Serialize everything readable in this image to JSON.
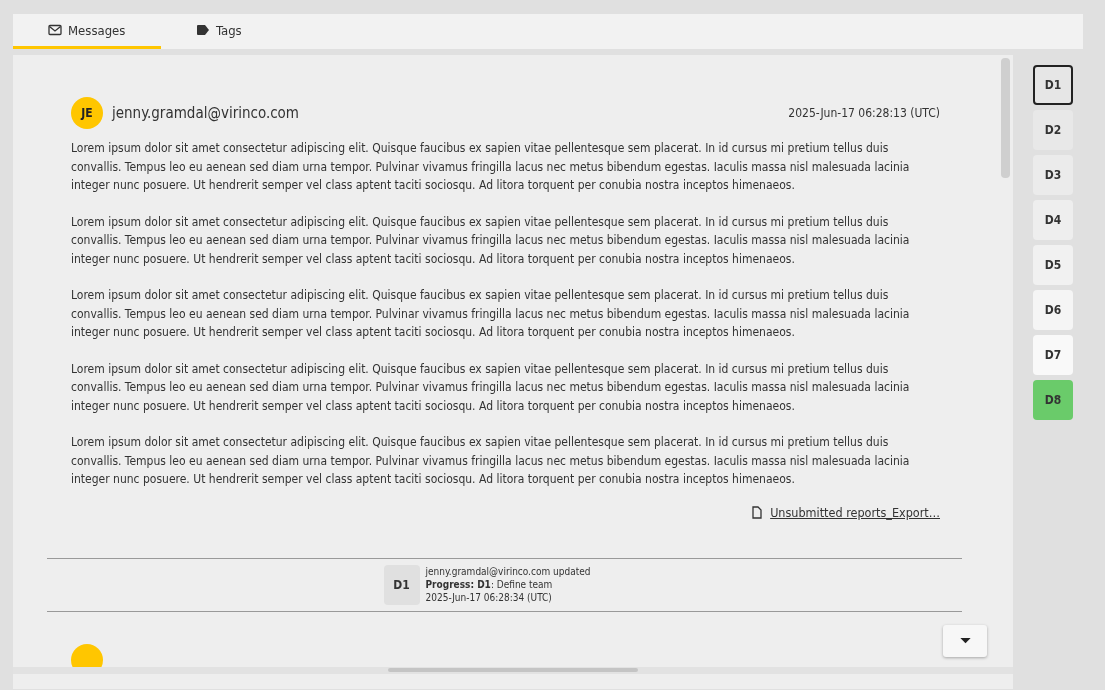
{
  "tabs": [
    {
      "label": "Messages",
      "kind": "mail",
      "selected": true
    },
    {
      "label": "Tags",
      "kind": "tag",
      "selected": false
    }
  ],
  "message": {
    "initials": "JE",
    "sender": "jenny.gramdal@virinco.com",
    "timestamp": "2025-Jun-17 06:28:13 (UTC)",
    "paragraphs": [
      "Lorem ipsum dolor sit amet consectetur adipiscing elit. Quisque faucibus ex sapien vitae pellentesque sem placerat. In id cursus mi pretium tellus duis convallis. Tempus leo eu aenean sed diam urna tempor. Pulvinar vivamus fringilla lacus nec metus bibendum egestas. Iaculis massa nisl malesuada lacinia integer nunc posuere. Ut hendrerit semper vel class aptent taciti sociosqu. Ad litora torquent per conubia nostra inceptos himenaeos.",
      "Lorem ipsum dolor sit amet consectetur adipiscing elit. Quisque faucibus ex sapien vitae pellentesque sem placerat. In id cursus mi pretium tellus duis convallis. Tempus leo eu aenean sed diam urna tempor. Pulvinar vivamus fringilla lacus nec metus bibendum egestas. Iaculis massa nisl malesuada lacinia integer nunc posuere. Ut hendrerit semper vel class aptent taciti sociosqu. Ad litora torquent per conubia nostra inceptos himenaeos.",
      "Lorem ipsum dolor sit amet consectetur adipiscing elit. Quisque faucibus ex sapien vitae pellentesque sem placerat. In id cursus mi pretium tellus duis convallis. Tempus leo eu aenean sed diam urna tempor. Pulvinar vivamus fringilla lacus nec metus bibendum egestas. Iaculis massa nisl malesuada lacinia integer nunc posuere. Ut hendrerit semper vel class aptent taciti sociosqu. Ad litora torquent per conubia nostra inceptos himenaeos.",
      "Lorem ipsum dolor sit amet consectetur adipiscing elit. Quisque faucibus ex sapien vitae pellentesque sem placerat. In id cursus mi pretium tellus duis convallis. Tempus leo eu aenean sed diam urna tempor. Pulvinar vivamus fringilla lacus nec metus bibendum egestas. Iaculis massa nisl malesuada lacinia integer nunc posuere. Ut hendrerit semper vel class aptent taciti sociosqu. Ad litora torquent per conubia nostra inceptos himenaeos.",
      "Lorem ipsum dolor sit amet consectetur adipiscing elit. Quisque faucibus ex sapien vitae pellentesque sem placerat. In id cursus mi pretium tellus duis convallis. Tempus leo eu aenean sed diam urna tempor. Pulvinar vivamus fringilla lacus nec metus bibendum egestas. Iaculis massa nisl malesuada lacinia integer nunc posuere. Ut hendrerit semper vel class aptent taciti sociosqu. Ad litora torquent per conubia nostra inceptos himenaeos."
    ],
    "attachment": "Unsubmitted reports_Export…"
  },
  "event": {
    "badge": "D1",
    "line": "jenny.gramdal@virinco.com updated",
    "detail": "**Progress:  D1**: Define team",
    "timestamp": "2025-Jun-17 06:28:34 (UTC)"
  },
  "steps": [
    {
      "label": "D1",
      "selected": true,
      "color": "#e6e6e6"
    },
    {
      "label": "D2",
      "selected": false,
      "color": "#e8e8e8"
    },
    {
      "label": "D3",
      "selected": false,
      "color": "#ebebeb"
    },
    {
      "label": "D4",
      "selected": false,
      "color": "#eeeeee"
    },
    {
      "label": "D5",
      "selected": false,
      "color": "#f1f1f1"
    },
    {
      "label": "D6",
      "selected": false,
      "color": "#f5f5f5"
    },
    {
      "label": "D7",
      "selected": false,
      "color": "#f9f9f9"
    },
    {
      "label": "D8",
      "selected": false,
      "color": "#6acb6a"
    }
  ]
}
